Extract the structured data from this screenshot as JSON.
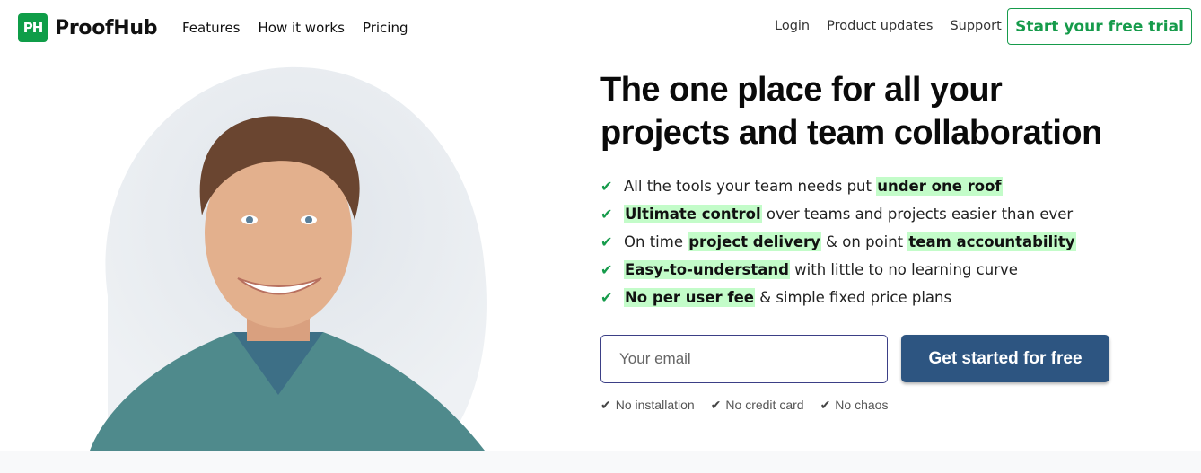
{
  "nav": {
    "logo_mark": "PH",
    "logo_text": "ProofHub",
    "left_links": [
      "Features",
      "How it works",
      "Pricing"
    ],
    "right_links": [
      "Login",
      "Product updates",
      "Support"
    ],
    "trial_button": "Start your free trial"
  },
  "hero": {
    "headline_line1": "The one place for all your",
    "headline_line2": "projects and team collaboration",
    "features": [
      [
        {
          "t": "All the tools your team needs put ",
          "h": false
        },
        {
          "t": "under one roof",
          "h": true
        }
      ],
      [
        {
          "t": "Ultimate control",
          "h": true
        },
        {
          "t": " over teams and projects easier than ever",
          "h": false
        }
      ],
      [
        {
          "t": "On time ",
          "h": false
        },
        {
          "t": "project delivery",
          "h": true
        },
        {
          "t": " & on point ",
          "h": false
        },
        {
          "t": "team accountability",
          "h": true
        }
      ],
      [
        {
          "t": "Easy-to-understand",
          "h": true
        },
        {
          "t": " with little to no learning curve",
          "h": false
        }
      ],
      [
        {
          "t": "No per user fee",
          "h": true
        },
        {
          "t": " & simple fixed price plans",
          "h": false
        }
      ]
    ],
    "email_placeholder": "Your email",
    "cta_label": "Get started for free",
    "perks": [
      "No installation",
      "No credit card",
      "No chaos"
    ]
  },
  "colors": {
    "brand_green": "#0f9d48",
    "cta_blue": "#2d5581",
    "highlight": "#c3fcc9"
  }
}
